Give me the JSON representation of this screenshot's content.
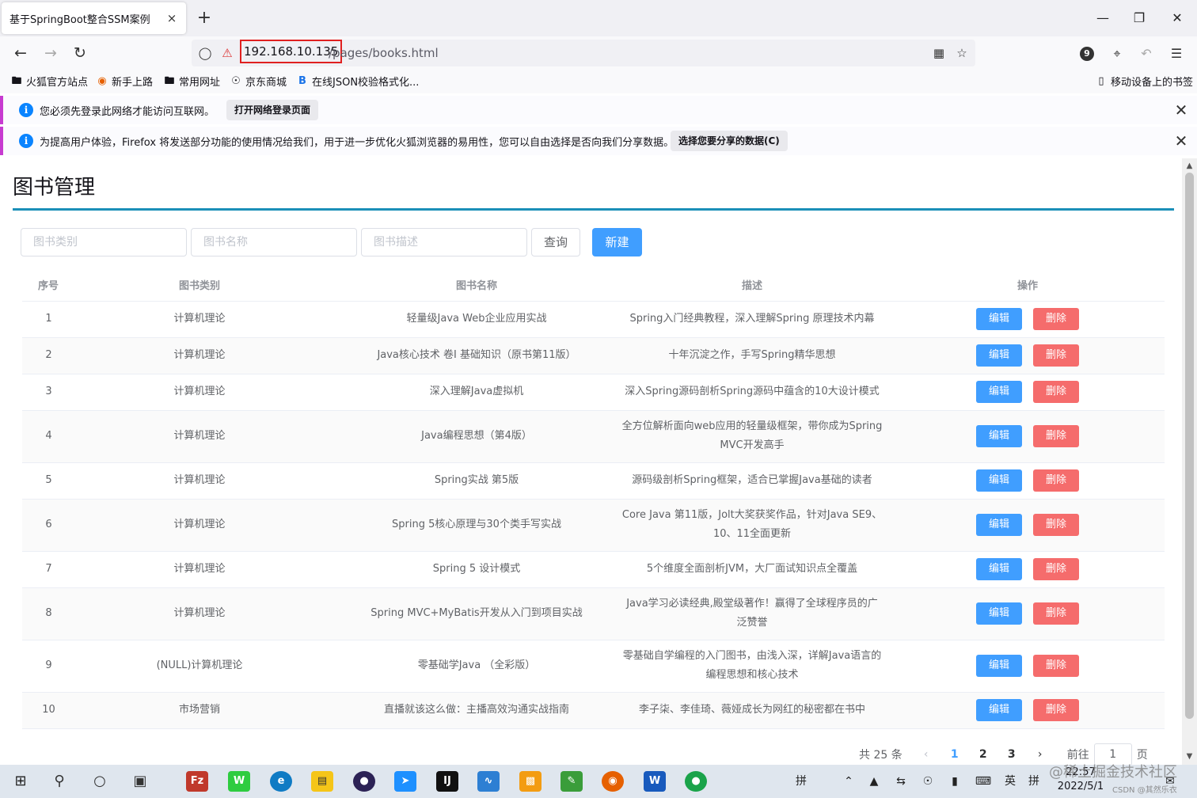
{
  "browser": {
    "tab_title": "基于SpringBoot整合SSM案例",
    "tab_close": "×",
    "new_tab": "+",
    "url_host": "192.168.10.135",
    "url_path": "/pages/books.html",
    "extension_badge": "9",
    "bookmarks": [
      {
        "label": "火狐官方站点",
        "icon": "folder-icon"
      },
      {
        "label": "新手上路",
        "icon": "firefox-icon"
      },
      {
        "label": "常用网址",
        "icon": "folder-icon"
      },
      {
        "label": "京东商城",
        "icon": "globe-icon"
      },
      {
        "label": "在线JSON校验格式化...",
        "icon": "bejson-icon"
      }
    ],
    "mobile_bookmarks": "移动设备上的书签",
    "notifications": [
      {
        "text": "您必须先登录此网络才能访问互联网。",
        "button": "打开网络登录页面"
      },
      {
        "text": "为提高用户体验，Firefox 将发送部分功能的使用情况给我们，用于进一步优化火狐浏览器的易用性，您可以自由选择是否向我们分享数据。",
        "button": "选择您要分享的数据(C)"
      }
    ]
  },
  "page": {
    "title": "图书管理",
    "filters": {
      "type_placeholder": "图书类别",
      "name_placeholder": "图书名称",
      "desc_placeholder": "图书描述"
    },
    "query_button": "查询",
    "new_button": "新建",
    "columns": [
      "序号",
      "图书类别",
      "图书名称",
      "描述",
      "操作"
    ],
    "edit_label": "编辑",
    "delete_label": "删除",
    "rows": [
      {
        "idx": "1",
        "type": "计算机理论",
        "name": "轻量级Java Web企业应用实战",
        "desc": "Spring入门经典教程，深入理解Spring 原理技术内幕"
      },
      {
        "idx": "2",
        "type": "计算机理论",
        "name": "Java核心技术 卷I 基础知识（原书第11版）",
        "desc": "十年沉淀之作，手写Spring精华思想"
      },
      {
        "idx": "3",
        "type": "计算机理论",
        "name": "深入理解Java虚拟机",
        "desc": "深入Spring源码剖析Spring源码中蕴含的10大设计模式"
      },
      {
        "idx": "4",
        "type": "计算机理论",
        "name": "Java编程思想（第4版）",
        "desc": "全方位解析面向web应用的轻量级框架，带你成为Spring MVC开发高手"
      },
      {
        "idx": "5",
        "type": "计算机理论",
        "name": "Spring实战 第5版",
        "desc": "源码级剖析Spring框架，适合已掌握Java基础的读者"
      },
      {
        "idx": "6",
        "type": "计算机理论",
        "name": "Spring 5核心原理与30个类手写实战",
        "desc": "Core Java 第11版，Jolt大奖获奖作品，针对Java SE9、10、11全面更新"
      },
      {
        "idx": "7",
        "type": "计算机理论",
        "name": "Spring 5 设计模式",
        "desc": "5个维度全面剖析JVM，大厂面试知识点全覆盖"
      },
      {
        "idx": "8",
        "type": "计算机理论",
        "name": "Spring MVC+MyBatis开发从入门到项目实战",
        "desc": "Java学习必读经典,殿堂级著作！赢得了全球程序员的广泛赞誉"
      },
      {
        "idx": "9",
        "type": "(NULL)计算机理论",
        "name": "零基础学Java （全彩版）",
        "desc": "零基础自学编程的入门图书，由浅入深，详解Java语言的编程思想和核心技术"
      },
      {
        "idx": "10",
        "type": "市场营销",
        "name": "直播就该这么做：主播高效沟通实战指南",
        "desc": "李子柒、李佳琦、薇娅成长为网红的秘密都在书中"
      }
    ],
    "pager": {
      "total": "共 25 条",
      "prev": "‹",
      "pages": [
        "1",
        "2",
        "3"
      ],
      "next": "›",
      "goto_label": "前往",
      "goto_value": "1",
      "goto_suffix": "页"
    }
  },
  "taskbar": {
    "ime_mode": "拼",
    "input_lang": "英",
    "ime_mode2": "拼",
    "time": "22:57",
    "date": "2022/5/1"
  },
  "watermark": {
    "text": "@稀土掘金技术社区",
    "sub": "CSDN @其然乐衣"
  },
  "colors": {
    "primary": "#409eff",
    "danger": "#f56c6c",
    "title_line": "#1b8fb8",
    "url_highlight": "#e02020"
  }
}
